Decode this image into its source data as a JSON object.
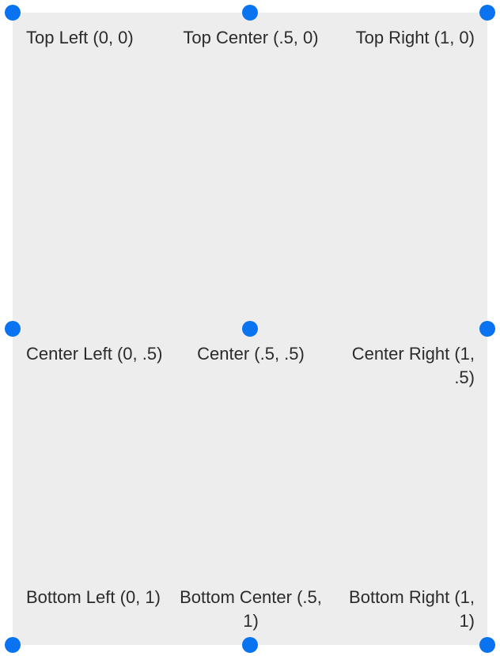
{
  "labels": {
    "top_left": "Top Left (0, 0)",
    "top_center": "Top Center (.5, 0)",
    "top_right": "Top Right (1, 0)",
    "center_left": "Center Left (0, .5)",
    "center": "Center (.5, .5)",
    "center_right": "Center Right (1, .5)",
    "bottom_left": "Bottom Left (0, 1)",
    "bottom_center": "Bottom Center (.5, 1)",
    "bottom_right": "Bottom Right (1, 1)"
  },
  "colors": {
    "handle": "#0a74f0",
    "panel": "#ededed",
    "text": "#2b2b2b"
  }
}
